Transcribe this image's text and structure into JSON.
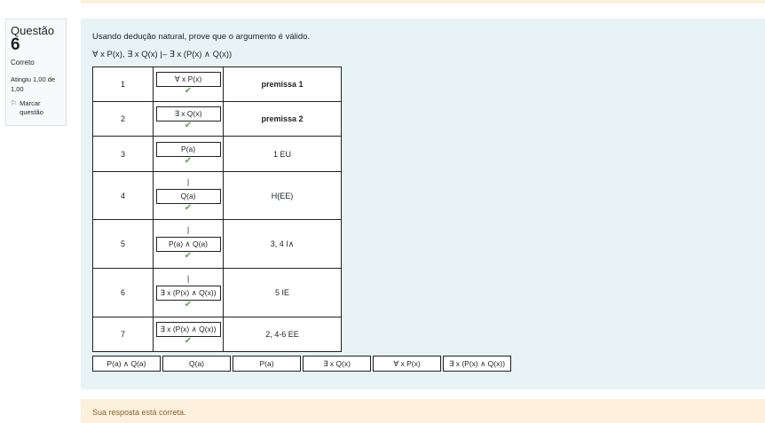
{
  "question": {
    "label": "Questão",
    "number": "6",
    "state": "Correto",
    "grade": "Atingiu 1,00 de 1,00",
    "flag_label": "Marcar questão"
  },
  "content": {
    "text": "Usando dedução natural, prove que o argumento é válido.",
    "formula": "∀ x P(x), ∃ x Q(x) |– ∃ x (P(x) ∧ Q(x))"
  },
  "rows": [
    {
      "num": "1",
      "formula": "∀ x P(x)",
      "just": "premissa 1",
      "bold": true,
      "bar": false
    },
    {
      "num": "2",
      "formula": "∃ x Q(x)",
      "just": "premissa 2",
      "bold": true,
      "bar": false
    },
    {
      "num": "3",
      "formula": "P(a)",
      "just": "1 EU",
      "bold": false,
      "bar": false
    },
    {
      "num": "4",
      "formula": "Q(a)",
      "just": "H(EE)",
      "bold": false,
      "bar": true
    },
    {
      "num": "5",
      "formula": "P(a) ∧ Q(a)",
      "just": "3, 4 I∧",
      "bold": false,
      "bar": true
    },
    {
      "num": "6",
      "formula": "∃ x (P(x) ∧ Q(x))",
      "just": "5 IE",
      "bold": false,
      "bar": true
    },
    {
      "num": "7",
      "formula": "∃ x (P(x) ∧ Q(x))",
      "just": "2, 4-6 EE",
      "bold": false,
      "bar": false
    }
  ],
  "symbols": {
    "check": "✔",
    "bar": "|"
  },
  "choices": [
    "P(a) ∧ Q(a)",
    "Q(a)",
    "P(a)",
    "∃ x Q(x)",
    "∀ x P(x)",
    "∃ x (P(x) ∧ Q(x))"
  ],
  "feedback": "Sua resposta está correta.",
  "colors": {
    "accent_green": "#5aa84a",
    "feedback_bg": "#fcefdc",
    "content_bg": "#e7f3f5"
  }
}
